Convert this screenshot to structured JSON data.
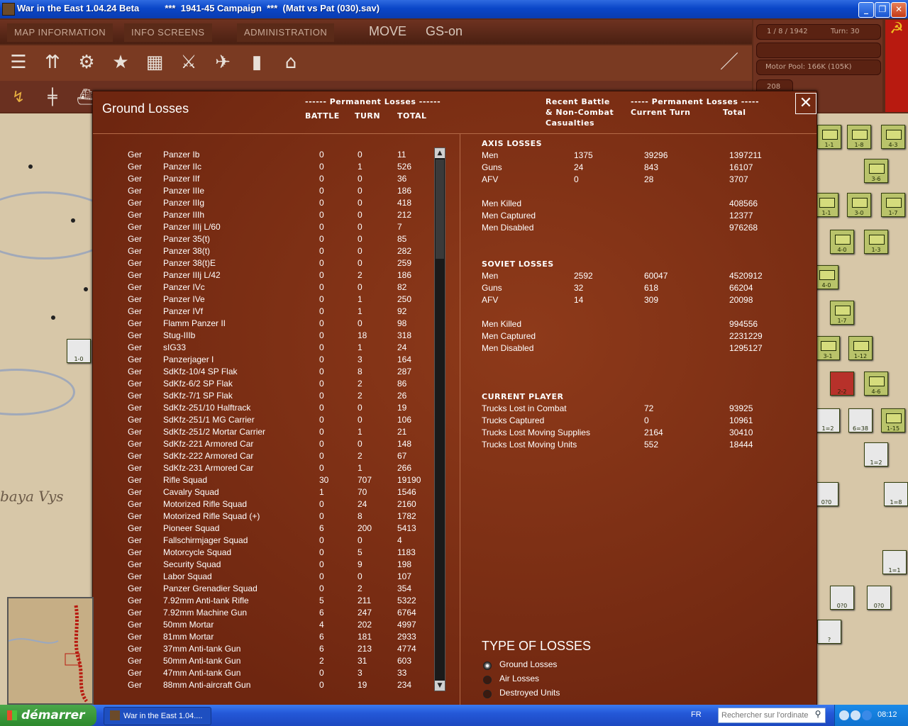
{
  "window": {
    "title": "War in the East 1.04.24 Beta          ***  1941-45 Campaign  ***  (Matt vs Pat (030).sav)"
  },
  "menu": {
    "map_information": "MAP INFORMATION",
    "info_screens": "INFO SCREENS",
    "administration": "ADMINISTRATION",
    "mode": "MOVE",
    "gs": "GS-on"
  },
  "info": {
    "date": "1 / 8 / 1942",
    "turn": "Turn: 30",
    "motor_pool": "Motor Pool: 166K (105K)",
    "admin_points": "208"
  },
  "map": {
    "place_label": "baya Vys"
  },
  "dialog": {
    "title": "Ground Losses",
    "perm_losses_left": "------ Permanent Losses ------",
    "col_battle": "BATTLE",
    "col_turn": "TURN",
    "col_total": "TOTAL",
    "recent_battle": [
      "Recent Battle",
      "& Non-Combat",
      "Casualties"
    ],
    "perm_losses_right": "----- Permanent Losses -----",
    "col_current_turn": "Current Turn",
    "col_total_right": "Total"
  },
  "losses": [
    {
      "nat": "Ger",
      "name": "Panzer Ib",
      "battle": "0",
      "turn": "0",
      "total": "11"
    },
    {
      "nat": "Ger",
      "name": "Panzer IIc",
      "battle": "0",
      "turn": "1",
      "total": "526"
    },
    {
      "nat": "Ger",
      "name": "Panzer IIf",
      "battle": "0",
      "turn": "0",
      "total": "36"
    },
    {
      "nat": "Ger",
      "name": "Panzer IIIe",
      "battle": "0",
      "turn": "0",
      "total": "186"
    },
    {
      "nat": "Ger",
      "name": "Panzer IIIg",
      "battle": "0",
      "turn": "0",
      "total": "418"
    },
    {
      "nat": "Ger",
      "name": "Panzer IIIh",
      "battle": "0",
      "turn": "0",
      "total": "212"
    },
    {
      "nat": "Ger",
      "name": "Panzer IIIj L/60",
      "battle": "0",
      "turn": "0",
      "total": "7"
    },
    {
      "nat": "Ger",
      "name": "Panzer 35(t)",
      "battle": "0",
      "turn": "0",
      "total": "85"
    },
    {
      "nat": "Ger",
      "name": "Panzer 38(t)",
      "battle": "0",
      "turn": "0",
      "total": "282"
    },
    {
      "nat": "Ger",
      "name": "Panzer 38(t)E",
      "battle": "0",
      "turn": "0",
      "total": "259"
    },
    {
      "nat": "Ger",
      "name": "Panzer IIIj L/42",
      "battle": "0",
      "turn": "2",
      "total": "186"
    },
    {
      "nat": "Ger",
      "name": "Panzer IVc",
      "battle": "0",
      "turn": "0",
      "total": "82"
    },
    {
      "nat": "Ger",
      "name": "Panzer IVe",
      "battle": "0",
      "turn": "1",
      "total": "250"
    },
    {
      "nat": "Ger",
      "name": "Panzer IVf",
      "battle": "0",
      "turn": "1",
      "total": "92"
    },
    {
      "nat": "Ger",
      "name": "Flamm Panzer II",
      "battle": "0",
      "turn": "0",
      "total": "98"
    },
    {
      "nat": "Ger",
      "name": "Stug-IIIb",
      "battle": "0",
      "turn": "18",
      "total": "318"
    },
    {
      "nat": "Ger",
      "name": "sIG33",
      "battle": "0",
      "turn": "1",
      "total": "24"
    },
    {
      "nat": "Ger",
      "name": "Panzerjager I",
      "battle": "0",
      "turn": "3",
      "total": "164"
    },
    {
      "nat": "Ger",
      "name": "SdKfz-10/4 SP Flak",
      "battle": "0",
      "turn": "8",
      "total": "287"
    },
    {
      "nat": "Ger",
      "name": "SdKfz-6/2 SP Flak",
      "battle": "0",
      "turn": "2",
      "total": "86"
    },
    {
      "nat": "Ger",
      "name": "SdKfz-7/1 SP Flak",
      "battle": "0",
      "turn": "2",
      "total": "26"
    },
    {
      "nat": "Ger",
      "name": "SdKfz-251/10 Halftrack",
      "battle": "0",
      "turn": "0",
      "total": "19"
    },
    {
      "nat": "Ger",
      "name": "SdKfz-251/1 MG Carrier",
      "battle": "0",
      "turn": "0",
      "total": "106"
    },
    {
      "nat": "Ger",
      "name": "SdKfz-251/2 Mortar Carrier",
      "battle": "0",
      "turn": "1",
      "total": "21"
    },
    {
      "nat": "Ger",
      "name": "SdKfz-221 Armored Car",
      "battle": "0",
      "turn": "0",
      "total": "148"
    },
    {
      "nat": "Ger",
      "name": "SdKfz-222 Armored Car",
      "battle": "0",
      "turn": "2",
      "total": "67"
    },
    {
      "nat": "Ger",
      "name": "SdKfz-231 Armored Car",
      "battle": "0",
      "turn": "1",
      "total": "266"
    },
    {
      "nat": "Ger",
      "name": "Rifle Squad",
      "battle": "30",
      "turn": "707",
      "total": "19190"
    },
    {
      "nat": "Ger",
      "name": "Cavalry Squad",
      "battle": "1",
      "turn": "70",
      "total": "1546"
    },
    {
      "nat": "Ger",
      "name": "Motorized Rifle Squad",
      "battle": "0",
      "turn": "24",
      "total": "2160"
    },
    {
      "nat": "Ger",
      "name": "Motorized Rifle Squad (+)",
      "battle": "0",
      "turn": "8",
      "total": "1782"
    },
    {
      "nat": "Ger",
      "name": "Pioneer Squad",
      "battle": "6",
      "turn": "200",
      "total": "5413"
    },
    {
      "nat": "Ger",
      "name": "Fallschirmjager Squad",
      "battle": "0",
      "turn": "0",
      "total": "4"
    },
    {
      "nat": "Ger",
      "name": "Motorcycle Squad",
      "battle": "0",
      "turn": "5",
      "total": "1183"
    },
    {
      "nat": "Ger",
      "name": "Security Squad",
      "battle": "0",
      "turn": "9",
      "total": "198"
    },
    {
      "nat": "Ger",
      "name": "Labor Squad",
      "battle": "0",
      "turn": "0",
      "total": "107"
    },
    {
      "nat": "Ger",
      "name": "Panzer Grenadier Squad",
      "battle": "0",
      "turn": "2",
      "total": "354"
    },
    {
      "nat": "Ger",
      "name": "7.92mm Anti-tank Rifle",
      "battle": "5",
      "turn": "211",
      "total": "5322"
    },
    {
      "nat": "Ger",
      "name": "7.92mm Machine Gun",
      "battle": "6",
      "turn": "247",
      "total": "6764"
    },
    {
      "nat": "Ger",
      "name": "50mm Mortar",
      "battle": "4",
      "turn": "202",
      "total": "4997"
    },
    {
      "nat": "Ger",
      "name": "81mm Mortar",
      "battle": "6",
      "turn": "181",
      "total": "2933"
    },
    {
      "nat": "Ger",
      "name": "37mm Anti-tank Gun",
      "battle": "6",
      "turn": "213",
      "total": "4774"
    },
    {
      "nat": "Ger",
      "name": "50mm Anti-tank Gun",
      "battle": "2",
      "turn": "31",
      "total": "603"
    },
    {
      "nat": "Ger",
      "name": "47mm Anti-tank Gun",
      "battle": "0",
      "turn": "3",
      "total": "33"
    },
    {
      "nat": "Ger",
      "name": "88mm Anti-aircraft Gun",
      "battle": "0",
      "turn": "19",
      "total": "234"
    }
  ],
  "axis": {
    "title": "AXIS LOSSES",
    "rows": [
      {
        "label": "Men",
        "recent": "1375",
        "current": "39296",
        "total": "1397211"
      },
      {
        "label": "Guns",
        "recent": "24",
        "current": "843",
        "total": "16107"
      },
      {
        "label": "AFV",
        "recent": "0",
        "current": "28",
        "total": "3707"
      }
    ],
    "detail": [
      {
        "label": "Men Killed",
        "total": "408566"
      },
      {
        "label": "Men Captured",
        "total": "12377"
      },
      {
        "label": "Men Disabled",
        "total": "976268"
      }
    ]
  },
  "soviet": {
    "title": "SOVIET LOSSES",
    "rows": [
      {
        "label": "Men",
        "recent": "2592",
        "current": "60047",
        "total": "4520912"
      },
      {
        "label": "Guns",
        "recent": "32",
        "current": "618",
        "total": "66204"
      },
      {
        "label": "AFV",
        "recent": "14",
        "current": "309",
        "total": "20098"
      }
    ],
    "detail": [
      {
        "label": "Men Killed",
        "total": "994556"
      },
      {
        "label": "Men Captured",
        "total": "2231229"
      },
      {
        "label": "Men Disabled",
        "total": "1295127"
      }
    ]
  },
  "current_player": {
    "title": "CURRENT PLAYER",
    "rows": [
      {
        "label": "Trucks Lost in Combat",
        "current": "72",
        "total": "93925"
      },
      {
        "label": "Trucks Captured",
        "current": "0",
        "total": "10961"
      },
      {
        "label": "Trucks Lost Moving Supplies",
        "current": "2164",
        "total": "30410"
      },
      {
        "label": "Trucks Lost Moving Units",
        "current": "552",
        "total": "18444"
      }
    ]
  },
  "type_of_losses": {
    "title": "TYPE OF LOSSES",
    "options": [
      "Ground Losses",
      "Air Losses",
      "Destroyed Units"
    ],
    "selected": "Ground Losses"
  },
  "taskbar": {
    "start": "démarrer",
    "app": "War in the East 1.04....",
    "lang": "FR",
    "search_placeholder": "Rechercher sur l'ordinateur",
    "clock": "08:12"
  },
  "colors": {
    "dialog_bg": "#7e2e14",
    "header_bg": "#5c2a18",
    "xp_blue": "#0a46c8",
    "start_green": "#2d8a2d"
  }
}
